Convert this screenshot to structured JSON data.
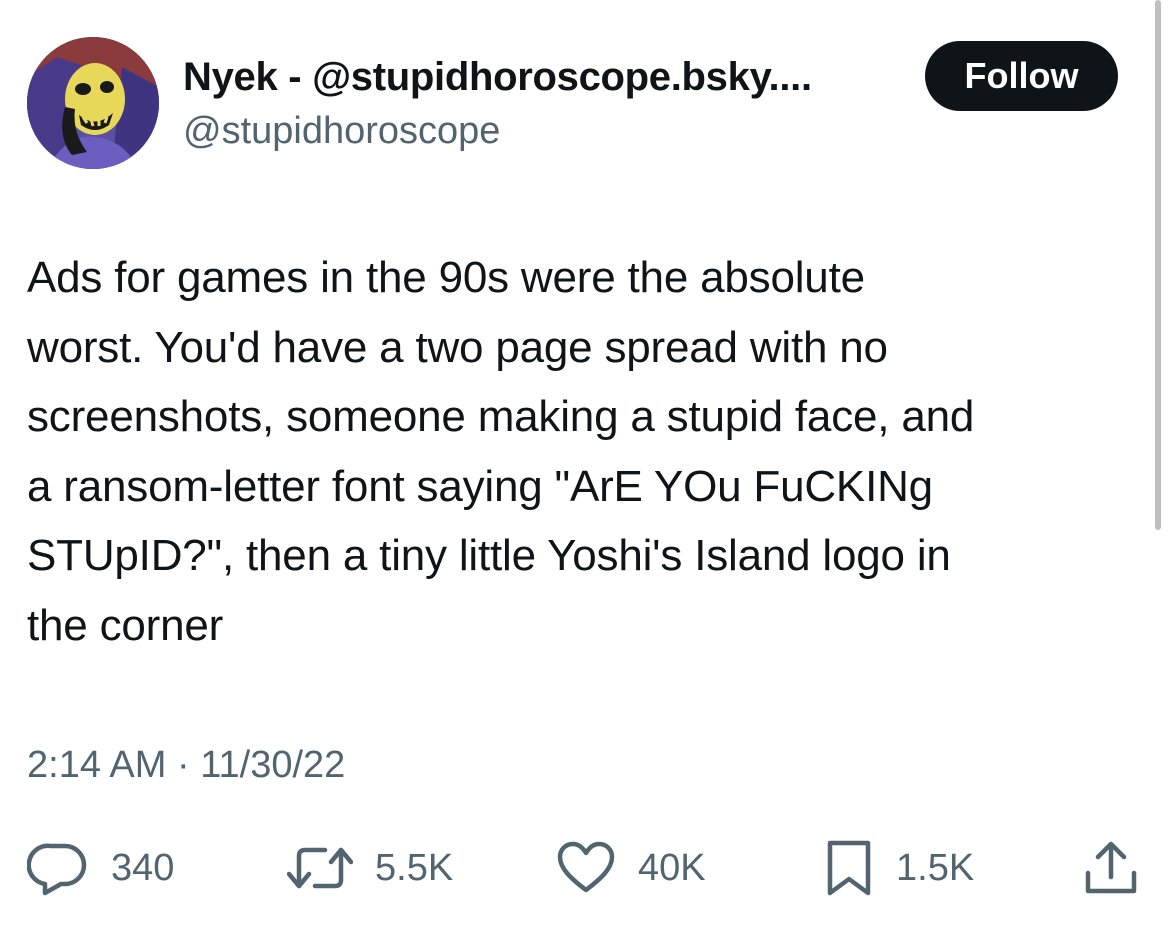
{
  "author": {
    "display_name": "Nyek - @stupidhoroscope.bsky....",
    "handle": "@stupidhoroscope",
    "avatar_icon": "skeletor-avatar"
  },
  "follow_button": {
    "label": "Follow"
  },
  "tweet": {
    "lines": [
      "Ads for games in the 90s were the absolute",
      "worst. You'd have a two page spread with no",
      "screenshots, someone making a stupid face, and",
      "a ransom-letter font saying \"ArE YOu FuCKINg",
      "STUpID?\", then a tiny little Yoshi's Island logo in",
      "the corner"
    ],
    "timestamp": "2:14 AM · 11/30/22"
  },
  "actions": {
    "replies": {
      "icon": "reply-icon",
      "count": "340"
    },
    "reposts": {
      "icon": "repost-icon",
      "count": "5.5K"
    },
    "likes": {
      "icon": "heart-icon",
      "count": "40K"
    },
    "bookmarks": {
      "icon": "bookmark-icon",
      "count": "1.5K"
    },
    "share": {
      "icon": "share-icon"
    }
  },
  "colors": {
    "text": "#0f1419",
    "secondary": "#536471",
    "button_bg": "#0f1419",
    "button_text": "#ffffff"
  }
}
